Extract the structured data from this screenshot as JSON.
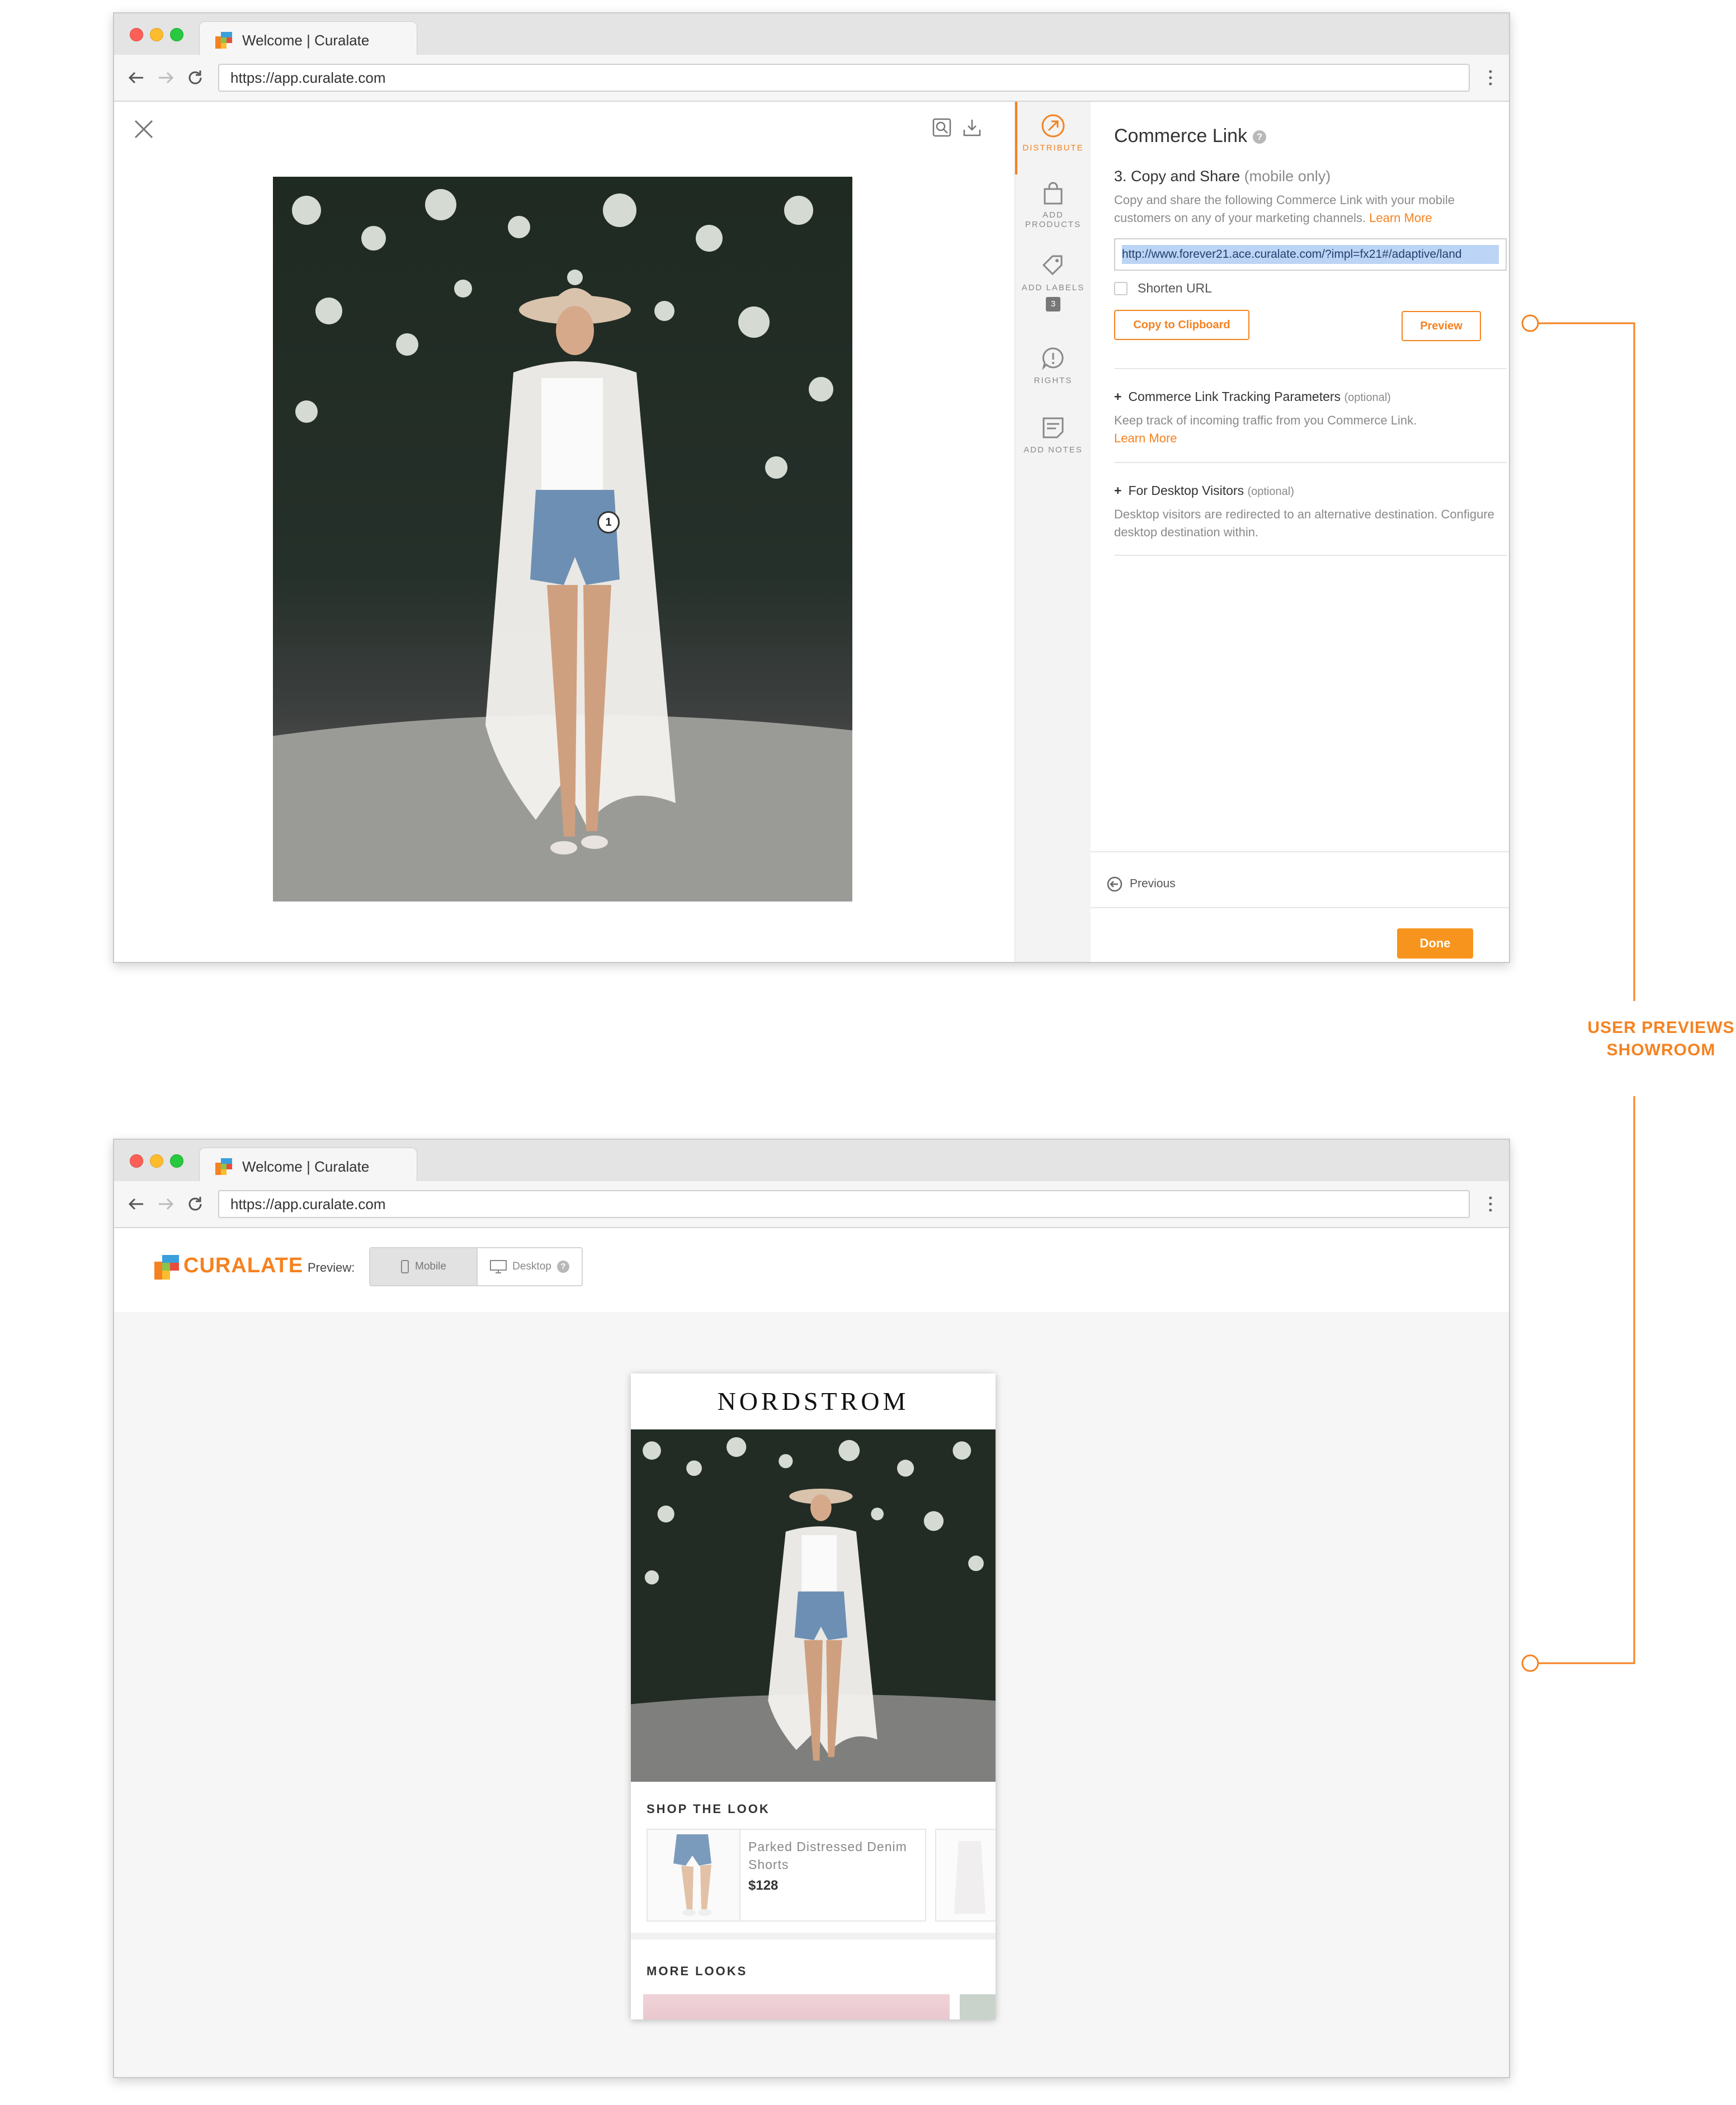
{
  "colors": {
    "accent": "#f58220",
    "done_button": "#f7941d",
    "selection": "#bcd4f5"
  },
  "browser": {
    "tab_title": "Welcome | Curalate",
    "url": "https://app.curalate.com"
  },
  "editor": {
    "icons": [
      "close-icon",
      "zoom-icon",
      "download-icon"
    ],
    "image_marker": "1",
    "rail": {
      "distribute": "DISTRIBUTE",
      "add_products": "ADD PRODUCTS",
      "add_labels": "ADD LABELS",
      "labels_count": "3",
      "rights": "RIGHTS",
      "add_notes": "ADD NOTES"
    },
    "panel": {
      "title": "Commerce Link",
      "help": "?",
      "step_title": "3. Copy and Share",
      "step_hint": "(mobile only)",
      "description": "Copy and share the following Commerce Link with your mobile customers on any of your marketing channels.",
      "learn_more": "Learn More",
      "link_value": "http://www.forever21.ace.curalate.com/?impl=fx21#/adaptive/land",
      "shorten_label": "Shorten URL",
      "copy_button": "Copy to Clipboard",
      "preview_button": "Preview",
      "tracking_title": "Commerce Link Tracking Parameters",
      "tracking_hint": "(optional)",
      "tracking_desc": "Keep track of incoming traffic from you Commerce Link.",
      "tracking_learn_more": "Learn More",
      "desktop_title": "For Desktop Visitors",
      "desktop_hint": "(optional)",
      "desktop_desc": "Desktop visitors are redirected to an alternative destination. Configure desktop destination within.",
      "previous": "Previous",
      "done": "Done"
    }
  },
  "showroom": {
    "logo_text": "CURALATE",
    "preview_label": "Preview:",
    "mobile_option": "Mobile",
    "desktop_option": "Desktop",
    "help": "?",
    "brand": "NORDSTROM",
    "shop_title": "SHOP THE LOOK",
    "product_name": "Parked Distressed Denim Shorts",
    "product_price": "$128",
    "more_title": "MORE LOOKS"
  },
  "annotation": {
    "label_line1": "USER PREVIEWS",
    "label_line2": "SHOWROOM"
  }
}
